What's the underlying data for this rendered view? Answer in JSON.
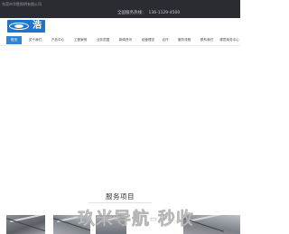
{
  "topbar": {
    "company": "东莞市华胜照明有限公司",
    "hotline_label": "全国服务热线：",
    "hotline_number": "136-1129-4500"
  },
  "logo": {
    "mark": "浩"
  },
  "nav": {
    "items": [
      {
        "label": "首页",
        "active": true
      },
      {
        "label": "关于我们"
      },
      {
        "label": "产品中心"
      },
      {
        "label": "工程案例"
      },
      {
        "label": "业务范围"
      },
      {
        "label": "新闻资讯"
      },
      {
        "label": "经营理念"
      },
      {
        "label": "合作"
      },
      {
        "label": "服务流程"
      },
      {
        "label": "联系我们"
      },
      {
        "label": "德意商务中心"
      }
    ]
  },
  "services": {
    "title": "服务项目",
    "subtitle": ""
  },
  "watermark": {
    "text": "玖米导航-秒收"
  },
  "colors": {
    "topbar": "#2a2c31",
    "accent": "#2f86d8",
    "logo": "#1f76c9"
  }
}
